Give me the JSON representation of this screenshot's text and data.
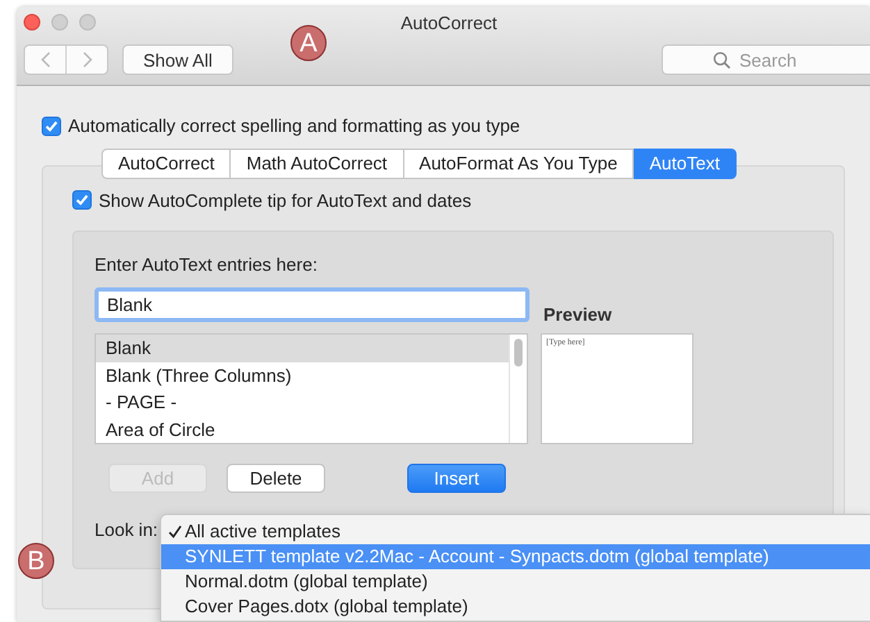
{
  "window": {
    "title": "AutoCorrect"
  },
  "toolbar": {
    "show_all": "Show All",
    "search": {
      "placeholder": "Search"
    }
  },
  "auto_correct": {
    "label": "Automatically correct spelling and formatting as you type",
    "checked": true
  },
  "tabs": [
    {
      "label": "AutoCorrect",
      "selected": false
    },
    {
      "label": "Math AutoCorrect",
      "selected": false
    },
    {
      "label": "AutoFormat As You Type",
      "selected": false
    },
    {
      "label": "AutoText",
      "selected": true
    }
  ],
  "show_tip": {
    "label": "Show AutoComplete tip for AutoText and dates",
    "checked": true
  },
  "entries_label": "Enter AutoText entries here:",
  "entry_field": {
    "value": "Blank"
  },
  "entries": [
    {
      "label": "Blank",
      "selected": true
    },
    {
      "label": "Blank (Three Columns)",
      "selected": false
    },
    {
      "label": "- PAGE -",
      "selected": false
    },
    {
      "label": "Area of Circle",
      "selected": false
    }
  ],
  "preview": {
    "label": "Preview",
    "text": "[Type here]"
  },
  "buttons": [
    {
      "label": "Add",
      "kind": "normal",
      "disabled": true
    },
    {
      "label": "Delete",
      "kind": "normal",
      "disabled": false
    },
    {
      "label": "Insert",
      "kind": "default",
      "disabled": false
    }
  ],
  "look_in": {
    "label": "Look in:",
    "options": [
      {
        "label": "All active templates",
        "checked": true,
        "selected": false
      },
      {
        "label": "SYNLETT template v2.2Mac - Account - Synpacts.dotm (global template)",
        "checked": false,
        "selected": true
      },
      {
        "label": "Normal.dotm (global template)",
        "checked": false,
        "selected": false
      },
      {
        "label": "Cover Pages.dotx (global template)",
        "checked": false,
        "selected": false
      }
    ]
  },
  "callouts": [
    {
      "letter": "A"
    },
    {
      "letter": "B"
    }
  ]
}
